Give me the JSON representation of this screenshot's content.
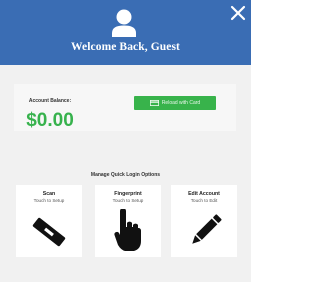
{
  "header": {
    "title": "Welcome Back, Guest",
    "user_icon": "user-icon",
    "close_icon": "close-icon",
    "background_color": "#3a6db4"
  },
  "account": {
    "balance_label": "Account Balance:",
    "balance_value": "$0.00",
    "balance_color": "#37b24d",
    "kiosk_button_label": "Reload with Card",
    "kiosk_button_icon": "credit-card-icon",
    "kiosk_button_color": "#38b34b"
  },
  "quick_login": {
    "heading": "Manage Quick Login Options",
    "options": [
      {
        "title": "Scan",
        "subtitle": "Touch to Setup",
        "icon": "scan-card-icon"
      },
      {
        "title": "Fingerprint",
        "subtitle": "Touch to Setup",
        "icon": "touch-hand-icon"
      },
      {
        "title": "Edit Account",
        "subtitle": "Touch to Edit",
        "icon": "pencil-icon"
      }
    ]
  }
}
